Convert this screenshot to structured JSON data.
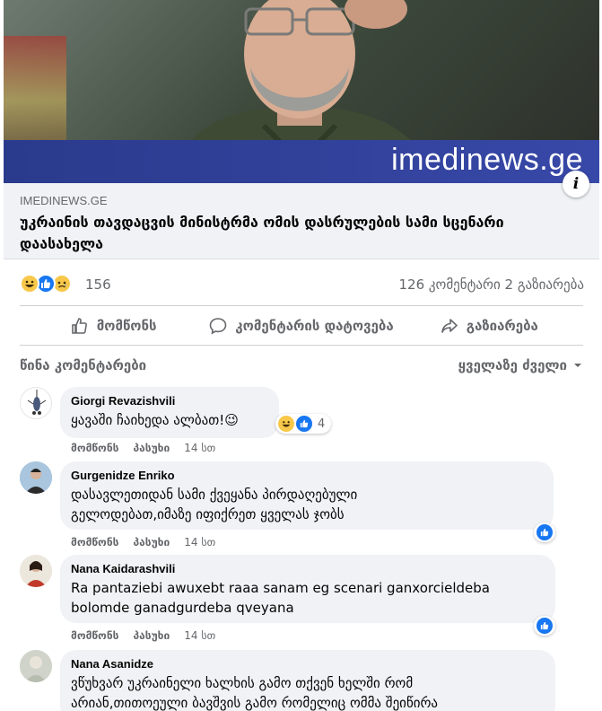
{
  "post": {
    "image_banner_text": "imedinews.ge",
    "info_label": "i",
    "domain": "IMEDINEWS.GE",
    "title": "უკრაინის თავდაცვის მინისტრმა ომის დასრულების სამი სცენარი დაასახელა"
  },
  "stats": {
    "reaction_icons": [
      "haha-icon",
      "like-icon",
      "sad-icon"
    ],
    "reaction_count": "156",
    "comments_shares": "126 კომენტარი  2 გაზიარება"
  },
  "actions": {
    "like": "მომწონს",
    "comment": "კომენტარის დატოვება",
    "share": "გაზიარება"
  },
  "comments_header": {
    "previous": "წინა კომენტარები",
    "sort": "ყველაზე ძველი"
  },
  "comments": [
    {
      "author": "Giorgi Revazishvili",
      "text": "ყავაში ჩაიხედა ალბათ!😉",
      "reaction_count": "4",
      "like_label": "მომწონს",
      "reply_label": "პასუხი",
      "time": "14 სთ"
    },
    {
      "author": "Gurgenidze Enriko",
      "text": "დასავლეთიდან სამი ქვეყანა პირდაღებული გელოდებათ,იმაზე იფიქრეთ ყველას ჯობს",
      "like_label": "მომწონს",
      "reply_label": "პასუხი",
      "time": "14 სთ"
    },
    {
      "author": "Nana Kaidarashvili",
      "text": "Ra pantaziebi awuxebt raaa sanam eg scenari ganxorcieldeba bolomde ganadgurdeba qveyana",
      "like_label": "მომწონს",
      "reply_label": "პასუხი",
      "time": "14 სთ"
    },
    {
      "author": "Nana Asanidze",
      "text": "ვწუხვარ უკრაინელი ხალხის გამო თქვენ ხელში რომ არიან,თითოეული ბავშვის გამო რომელიც ომმა შეიწირა"
    }
  ],
  "colors": {
    "brand_blue": "#1877f2",
    "secondary_text": "#65676b",
    "bubble_bg": "#f0f2f5"
  }
}
